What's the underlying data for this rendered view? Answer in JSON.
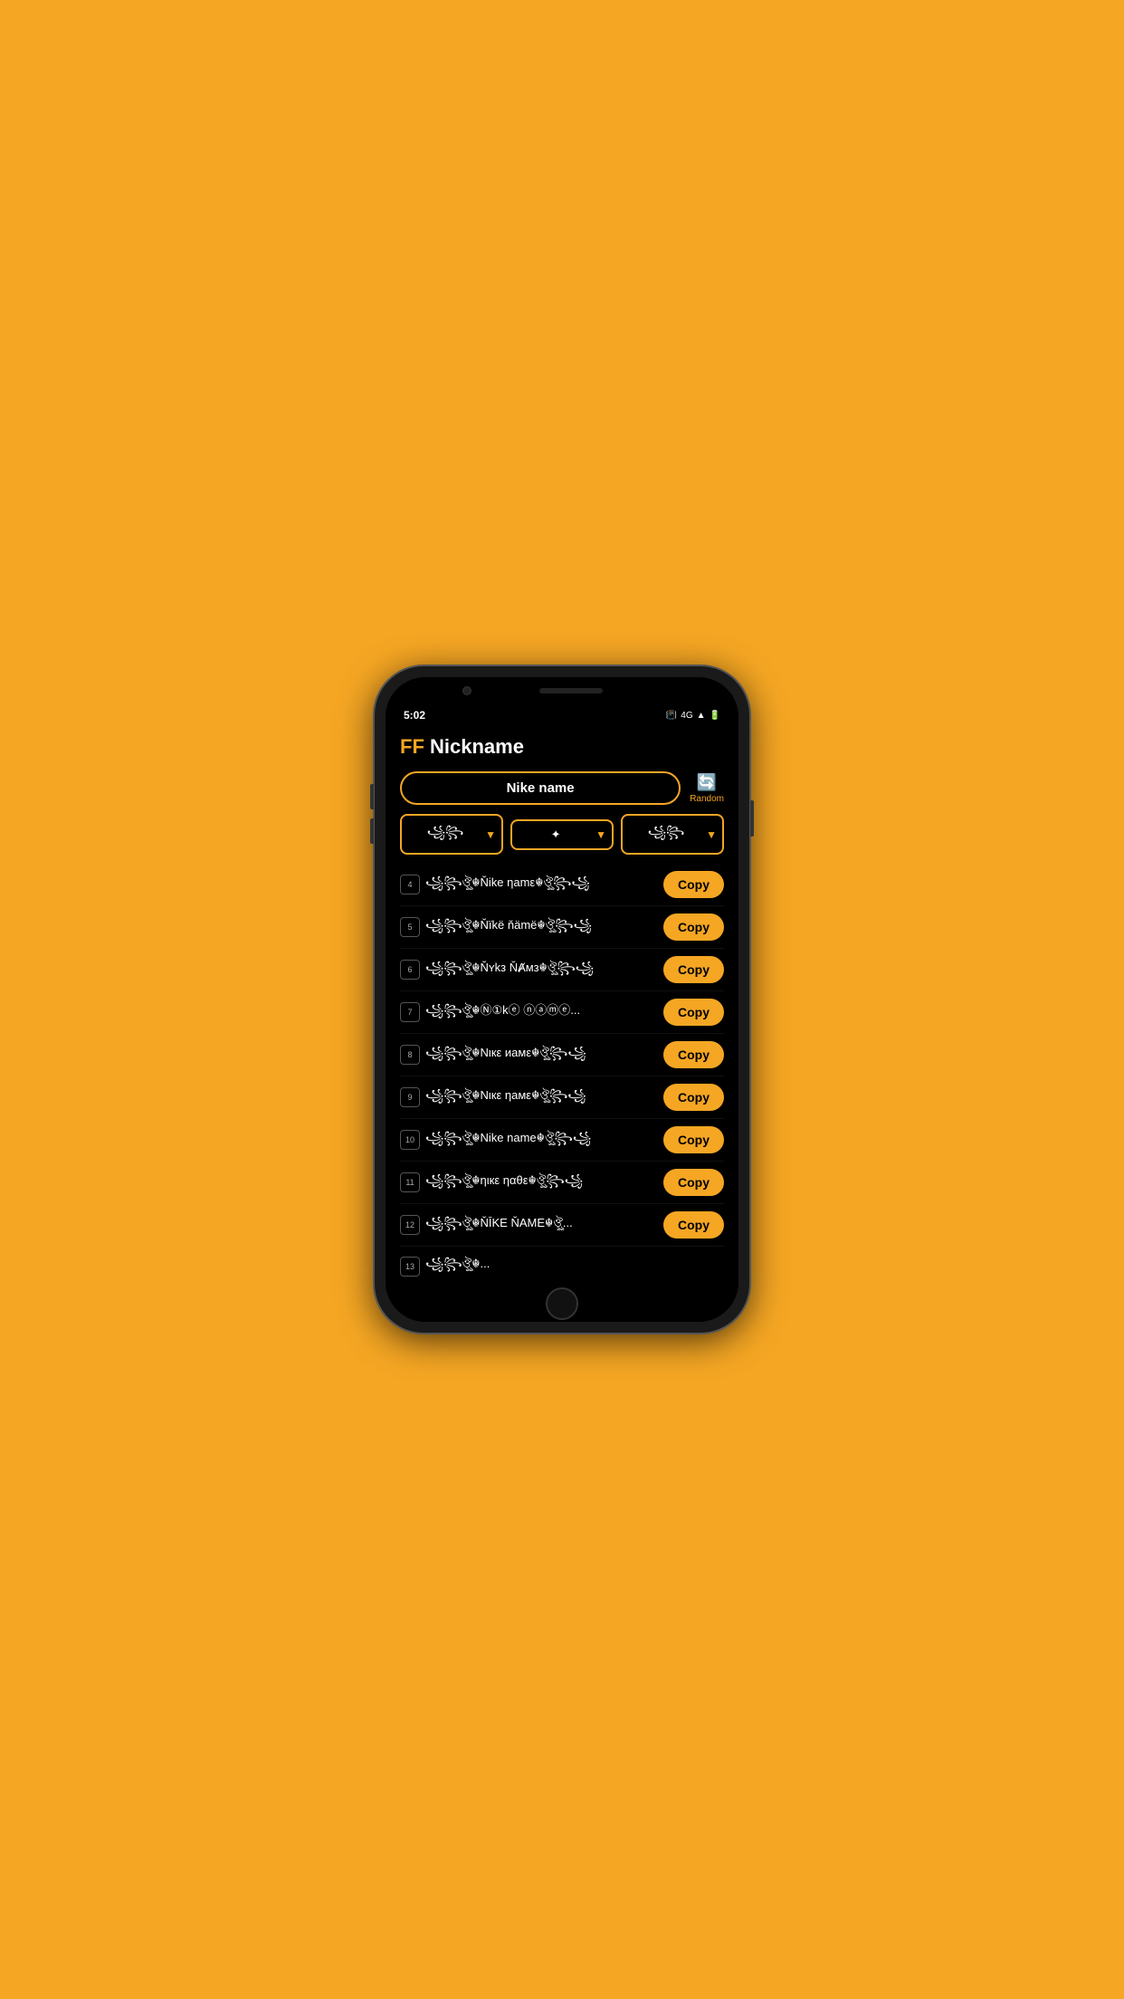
{
  "statusBar": {
    "time": "5:02",
    "icons": "📳 4G 📶 🔋"
  },
  "header": {
    "titleFF": "FF",
    "titleRest": " Nickname"
  },
  "search": {
    "value": "Nike name",
    "placeholder": "Nike name"
  },
  "random": {
    "label": "Random",
    "icon": "🔄"
  },
  "filters": [
    {
      "label": "꧁꧂",
      "symbol": "꧁꧂"
    },
    {
      "label": "✦",
      "symbol": "✦"
    },
    {
      "label": "꧁꧂",
      "symbol": "꧁꧂"
    }
  ],
  "nicknames": [
    {
      "num": "4",
      "text": "꧁꧂ঔৣ☬Ňike ηamε☬ঔৣ꧂꧁"
    },
    {
      "num": "5",
      "text": "꧁꧂ঔৣ☬Ňïkë ňämë☬ঔৣ꧂꧁"
    },
    {
      "num": "6",
      "text": "꧁꧂ঔৣ☬Ňʏkз ŇȺмз☬ঔৣ꧂꧁"
    },
    {
      "num": "7",
      "text": "꧁꧂ঔৣ☬Ⓝ①kⓔ ⓝⓐⓜⓔ..."
    },
    {
      "num": "8",
      "text": "꧁꧂ঔৣ☬Nιкε иамε☬ঔৣ꧂꧁"
    },
    {
      "num": "9",
      "text": "꧁꧂ঔৣ☬Nιкε ηамε☬ঔৣ꧂꧁"
    },
    {
      "num": "10",
      "text": "꧁꧂ঔৣ☬Nike name☬ঔৣ꧂꧁"
    },
    {
      "num": "11",
      "text": "꧁꧂ঔৣ☬ηιкε ηαθε☬ঔৣ꧂꧁"
    },
    {
      "num": "12",
      "text": "꧁꧂ঔৣ☬ŇĪKΕ ŇАМΕ☬ঔৣ..."
    },
    {
      "num": "13",
      "text": "꧁꧂ঔৣ☬..."
    }
  ],
  "copyLabel": "Copy"
}
